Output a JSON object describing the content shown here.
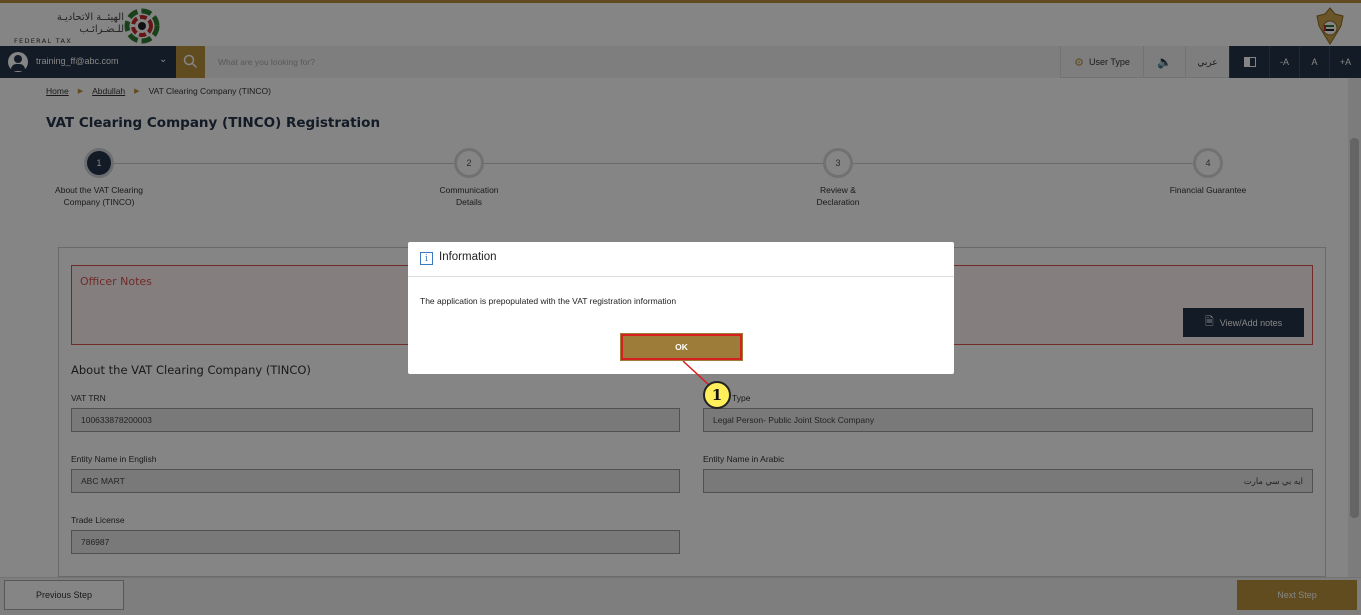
{
  "header": {
    "logo_arabic": "الهيئــة الاتحاديـة للـضـرائـب",
    "logo_english": "FEDERAL TAX AUTHORITY"
  },
  "navbar": {
    "user_email": "training_ff@abc.com",
    "search_placeholder": "What are you looking for?",
    "user_type_label": "User Type",
    "audio_icon_glyph": "🔈",
    "arabic_label": "عربي",
    "font_decrease": "-A",
    "font_normal": "A",
    "font_increase": "+A"
  },
  "breadcrumb": {
    "home": "Home",
    "level2": "Abdullah",
    "current": "VAT Clearing Company (TINCO)"
  },
  "page_title": "VAT Clearing Company (TINCO) Registration",
  "stepper": {
    "steps": [
      {
        "number": "1",
        "label": "About the VAT Clearing Company (TINCO)",
        "state": "active"
      },
      {
        "number": "2",
        "label": "Communication Details",
        "state": "pending"
      },
      {
        "number": "3",
        "label": "Review & Declaration",
        "state": "pending"
      },
      {
        "number": "4",
        "label": "Financial Guarantee",
        "state": "pending"
      }
    ]
  },
  "officer_notes": {
    "title": "Officer Notes",
    "button_label": "View/Add notes"
  },
  "section": {
    "title": "About the VAT Clearing Company (TINCO)"
  },
  "fields": {
    "vat_trn": {
      "label": "VAT TRN",
      "value": "100633878200003"
    },
    "legal_type": {
      "label": "Type",
      "value": "Legal Person- Public Joint Stock Company"
    },
    "name_en": {
      "label": "Entity Name in English",
      "value": "ABC MART"
    },
    "name_ar": {
      "label": "Entity Name in Arabic",
      "value": "ايه بي سي مارت"
    },
    "trade_license": {
      "label": "Trade License",
      "value": "786987"
    }
  },
  "footer": {
    "prev_label": "Previous Step",
    "next_label": "Next Step"
  },
  "modal": {
    "icon_glyph": "i",
    "title": "Information",
    "message": "The application is prepopulated with the VAT registration information",
    "ok_label": "OK"
  },
  "callout": {
    "number": "1"
  },
  "colors": {
    "gold": "#b8923c",
    "navy": "#23344a",
    "alert_red": "#d9534f",
    "callout_yellow": "#ffef5a"
  }
}
